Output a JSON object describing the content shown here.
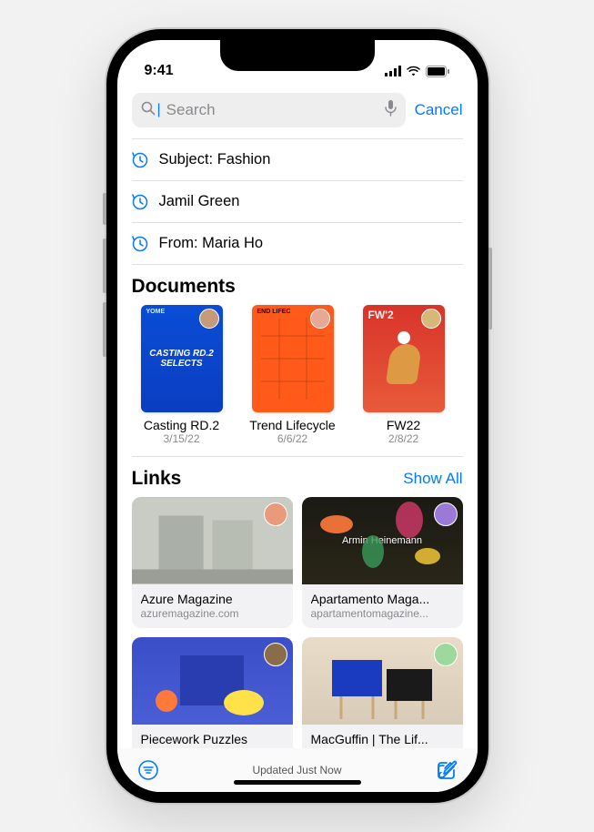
{
  "status": {
    "time": "9:41"
  },
  "search": {
    "placeholder": "Search",
    "cancel": "Cancel"
  },
  "suggestions": [
    {
      "text": "Subject: Fashion"
    },
    {
      "text": "Jamil Green"
    },
    {
      "text": "From: Maria Ho"
    }
  ],
  "documents": {
    "title": "Documents",
    "items": [
      {
        "name": "Casting RD.2",
        "date": "3/15/22",
        "thumb_label": "YOME",
        "thumb_text": "CASTING RD.2 SELECTS",
        "avatar_color": "#c69b7a"
      },
      {
        "name": "Trend Lifecycle",
        "date": "6/6/22",
        "thumb_label": "END LIFEC",
        "thumb_text": "",
        "avatar_color": "#e8a896"
      },
      {
        "name": "FW22",
        "date": "2/8/22",
        "thumb_label": "FW'2",
        "thumb_text": "",
        "avatar_color": "#d6b878"
      }
    ]
  },
  "links": {
    "title": "Links",
    "show_all": "Show All",
    "items": [
      {
        "title": "Azure Magazine",
        "domain": "azuremagazine.com",
        "overlay": "",
        "avatar_color": "#e89a7a",
        "bg": "linear-gradient(#b8c4bd,#cfd4cd)"
      },
      {
        "title": "Apartamento Maga...",
        "domain": "apartamentomagazine...",
        "overlay": "Armin Heinemann",
        "avatar_color": "#9a7ad6",
        "bg": "linear-gradient(#1a1a14,#2a2618)"
      },
      {
        "title": "Piecework Puzzles",
        "domain": "",
        "overlay": "",
        "avatar_color": "#8a6b4a",
        "bg": "linear-gradient(#3a4ec8,#4a5ed6)"
      },
      {
        "title": "MacGuffin | The Lif...",
        "domain": "",
        "overlay": "",
        "avatar_color": "#9dd89d",
        "bg": "linear-gradient(#e8dcc8,#d8ccb8)"
      }
    ]
  },
  "toolbar": {
    "status": "Updated Just Now"
  },
  "colors": {
    "accent": "#007aff"
  }
}
